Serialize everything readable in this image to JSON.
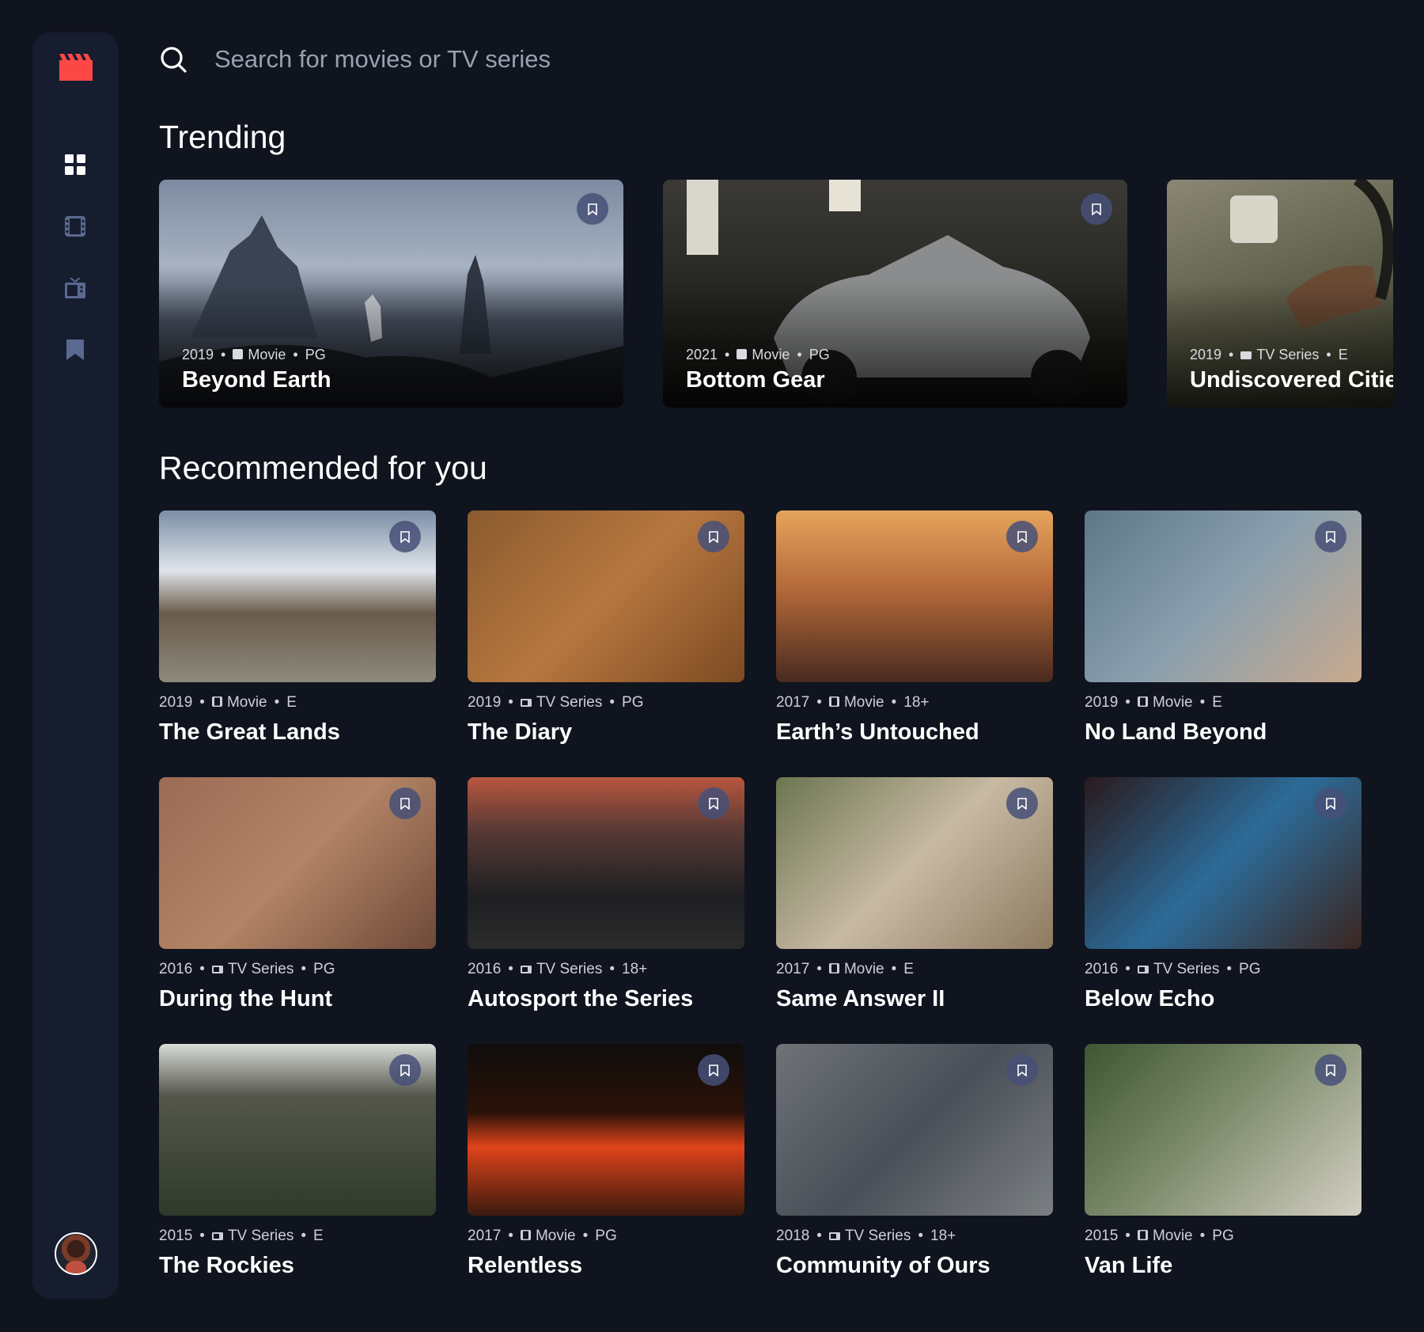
{
  "colors": {
    "background": "#10141e",
    "sidebar": "#161d2f",
    "accent": "#fc4747",
    "nav_inactive": "#5a698f",
    "bookmark_bg": "#5a698f"
  },
  "sidebar": {
    "logo_icon": "film-clapper-icon",
    "items": [
      {
        "icon": "home-grid-icon",
        "active": true
      },
      {
        "icon": "movies-icon",
        "active": false
      },
      {
        "icon": "tv-series-icon",
        "active": false
      },
      {
        "icon": "bookmark-icon",
        "active": false
      }
    ],
    "avatar_icon": "user-avatar"
  },
  "search": {
    "placeholder": "Search for movies or TV series",
    "value": ""
  },
  "trending": {
    "title": "Trending",
    "items": [
      {
        "year": "2019",
        "category": "Movie",
        "rating": "PG",
        "title": "Beyond Earth"
      },
      {
        "year": "2021",
        "category": "Movie",
        "rating": "PG",
        "title": "Bottom Gear"
      },
      {
        "year": "2019",
        "category": "TV Series",
        "rating": "E",
        "title": "Undiscovered Cities"
      }
    ]
  },
  "recommended": {
    "title": "Recommended for you",
    "items": [
      {
        "year": "2019",
        "category": "Movie",
        "rating": "E",
        "title": "The Great Lands"
      },
      {
        "year": "2019",
        "category": "TV Series",
        "rating": "PG",
        "title": "The Diary"
      },
      {
        "year": "2017",
        "category": "Movie",
        "rating": "18+",
        "title": "Earth’s Untouched"
      },
      {
        "year": "2019",
        "category": "Movie",
        "rating": "E",
        "title": "No Land Beyond"
      },
      {
        "year": "2016",
        "category": "TV Series",
        "rating": "PG",
        "title": "During the Hunt"
      },
      {
        "year": "2016",
        "category": "TV Series",
        "rating": "18+",
        "title": "Autosport the Series"
      },
      {
        "year": "2017",
        "category": "Movie",
        "rating": "E",
        "title": "Same Answer II"
      },
      {
        "year": "2016",
        "category": "TV Series",
        "rating": "PG",
        "title": "Below Echo"
      },
      {
        "year": "2015",
        "category": "TV Series",
        "rating": "E",
        "title": "The Rockies"
      },
      {
        "year": "2017",
        "category": "Movie",
        "rating": "PG",
        "title": "Relentless"
      },
      {
        "year": "2018",
        "category": "TV Series",
        "rating": "18+",
        "title": "Community of Ours"
      },
      {
        "year": "2015",
        "category": "Movie",
        "rating": "PG",
        "title": "Van Life"
      }
    ]
  },
  "separator": "•"
}
